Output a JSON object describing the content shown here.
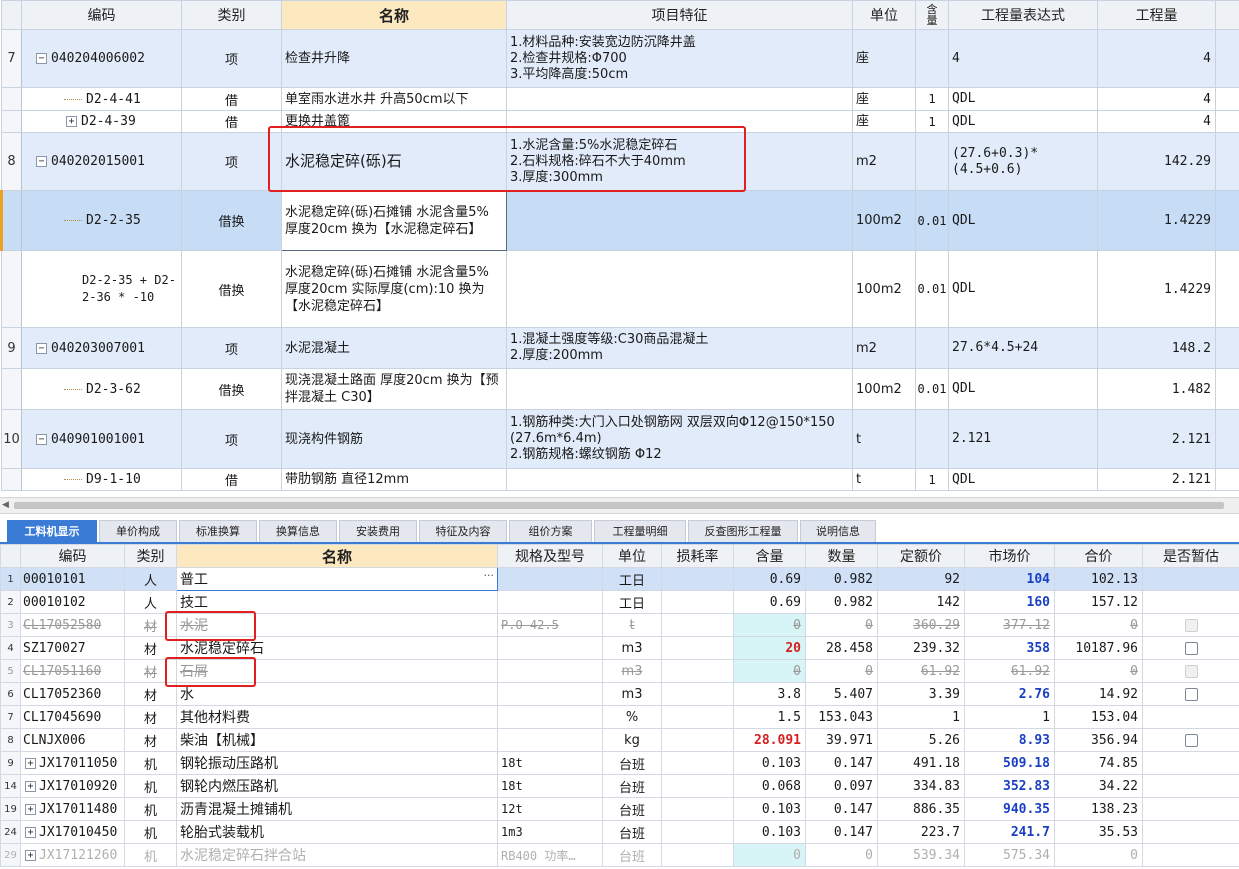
{
  "top": {
    "headers": {
      "code": "编码",
      "type": "类别",
      "name": "名称",
      "feature": "项目特征",
      "unit": "单位",
      "qty_ratio": "含量",
      "expr": "工程量表达式",
      "amount": "工程量"
    },
    "rows": [
      {
        "idx": "7",
        "code": "040204006002",
        "type": "项",
        "name": "检查井升降",
        "feature": "1.材料品种:安装宽边防沉降井盖\n2.检查井规格:Φ700\n3.平均降高度:50cm",
        "unit": "座",
        "ratio": "",
        "expr": "4",
        "amount": "4"
      },
      {
        "idx": "",
        "code": "D2-4-41",
        "type": "借",
        "name": "单室雨水进水井 升高50cm以下",
        "feature": "",
        "unit": "座",
        "ratio": "1",
        "expr": "QDL",
        "amount": "4"
      },
      {
        "idx": "",
        "code": "D2-4-39",
        "type": "借",
        "name": "更换井盖篦",
        "feature": "",
        "unit": "座",
        "ratio": "1",
        "expr": "QDL",
        "amount": "4"
      },
      {
        "idx": "8",
        "code": "040202015001",
        "type": "项",
        "name": "水泥稳定碎(砾)石",
        "feature": "1.水泥含量:5%水泥稳定碎石\n2.石料规格:碎石不大于40mm\n3.厚度:300mm",
        "unit": "m2",
        "ratio": "",
        "expr": "(27.6+0.3)*(4.5+0.6)",
        "amount": "142.29"
      },
      {
        "idx": "",
        "code": "D2-2-35",
        "type": "借换",
        "name": "水泥稳定碎(砾)石摊铺 水泥含量5% 厚度20cm  换为【水泥稳定碎石】",
        "feature": "",
        "unit": "100m2",
        "ratio": "0.01",
        "expr": "QDL",
        "amount": "1.4229"
      },
      {
        "idx": "",
        "code": "D2-2-35 + D2-2-36 * -10",
        "type": "借换",
        "name": "水泥稳定碎(砾)石摊铺 水泥含量5% 厚度20cm  实际厚度(cm):10  换为【水泥稳定碎石】",
        "feature": "",
        "unit": "100m2",
        "ratio": "0.01",
        "expr": "QDL",
        "amount": "1.4229"
      },
      {
        "idx": "9",
        "code": "040203007001",
        "type": "项",
        "name": "水泥混凝土",
        "feature": "1.混凝土强度等级:C30商品混凝土\n2.厚度:200mm",
        "unit": "m2",
        "ratio": "",
        "expr": "27.6*4.5+24",
        "amount": "148.2"
      },
      {
        "idx": "",
        "code": "D2-3-62",
        "type": "借换",
        "name": "现浇混凝土路面 厚度20cm  换为【预拌混凝土 C30】",
        "feature": "",
        "unit": "100m2",
        "ratio": "0.01",
        "expr": "QDL",
        "amount": "1.482"
      },
      {
        "idx": "10",
        "code": "040901001001",
        "type": "项",
        "name": "现浇构件钢筋",
        "feature": "1.钢筋种类:大门入口处钢筋网 双层双向Φ12@150*150 (27.6m*6.4m)\n2.钢筋规格:螺纹钢筋 Φ12",
        "unit": "t",
        "ratio": "",
        "expr": "2.121",
        "amount": "2.121"
      },
      {
        "idx": "",
        "code": "D9-1-10",
        "type": "借",
        "name": "带肋钢筋 直径12mm",
        "feature": "",
        "unit": "t",
        "ratio": "1",
        "expr": "QDL",
        "amount": "2.121"
      }
    ]
  },
  "tabs": [
    "工料机显示",
    "单价构成",
    "标准换算",
    "换算信息",
    "安装费用",
    "特征及内容",
    "组价方案",
    "工程量明细",
    "反查图形工程量",
    "说明信息"
  ],
  "bottom": {
    "headers": {
      "code": "编码",
      "type": "类别",
      "name": "名称",
      "spec": "规格及型号",
      "unit": "单位",
      "loss": "损耗率",
      "content": "含量",
      "qty": "数量",
      "quota_price": "定额价",
      "market_price": "市场价",
      "total": "合价",
      "provisional": "是否暂估"
    },
    "rows": [
      {
        "idx": "1",
        "code": "00010101",
        "type": "人",
        "name": "普工",
        "spec": "",
        "unit": "工日",
        "loss": "",
        "content": "0.69",
        "qty": "0.982",
        "quota": "92",
        "market": "104",
        "total": "102.13"
      },
      {
        "idx": "2",
        "code": "00010102",
        "type": "人",
        "name": "技工",
        "spec": "",
        "unit": "工日",
        "loss": "",
        "content": "0.69",
        "qty": "0.982",
        "quota": "142",
        "market": "160",
        "total": "157.12"
      },
      {
        "idx": "3",
        "code": "CL17052580",
        "type": "材",
        "name": "水泥",
        "spec": "P.O 42.5",
        "unit": "t",
        "loss": "",
        "content": "0",
        "qty": "0",
        "quota": "360.29",
        "market": "377.12",
        "total": "0"
      },
      {
        "idx": "4",
        "code": "SZ170027",
        "type": "材",
        "name": "水泥稳定碎石",
        "spec": "",
        "unit": "m3",
        "loss": "",
        "content": "20",
        "qty": "28.458",
        "quota": "239.32",
        "market": "358",
        "total": "10187.96"
      },
      {
        "idx": "5",
        "code": "CL17051160",
        "type": "材",
        "name": "石屑",
        "spec": "",
        "unit": "m3",
        "loss": "",
        "content": "0",
        "qty": "0",
        "quota": "61.92",
        "market": "61.92",
        "total": "0"
      },
      {
        "idx": "6",
        "code": "CL17052360",
        "type": "材",
        "name": "水",
        "spec": "",
        "unit": "m3",
        "loss": "",
        "content": "3.8",
        "qty": "5.407",
        "quota": "3.39",
        "market": "2.76",
        "total": "14.92"
      },
      {
        "idx": "7",
        "code": "CL17045690",
        "type": "材",
        "name": "其他材料费",
        "spec": "",
        "unit": "%",
        "loss": "",
        "content": "1.5",
        "qty": "153.043",
        "quota": "1",
        "market": "1",
        "total": "153.04"
      },
      {
        "idx": "8",
        "code": "CLNJX006",
        "type": "材",
        "name": "柴油【机械】",
        "spec": "",
        "unit": "kg",
        "loss": "",
        "content": "28.091",
        "qty": "39.971",
        "quota": "5.26",
        "market": "8.93",
        "total": "356.94"
      },
      {
        "idx": "9",
        "code": "JX17011050",
        "type": "机",
        "name": "钢轮振动压路机",
        "spec": "18t",
        "unit": "台班",
        "loss": "",
        "content": "0.103",
        "qty": "0.147",
        "quota": "491.18",
        "market": "509.18",
        "total": "74.85"
      },
      {
        "idx": "14",
        "code": "JX17010920",
        "type": "机",
        "name": "钢轮内燃压路机",
        "spec": "18t",
        "unit": "台班",
        "loss": "",
        "content": "0.068",
        "qty": "0.097",
        "quota": "334.83",
        "market": "352.83",
        "total": "34.22"
      },
      {
        "idx": "19",
        "code": "JX17011480",
        "type": "机",
        "name": "沥青混凝土摊铺机",
        "spec": "12t",
        "unit": "台班",
        "loss": "",
        "content": "0.103",
        "qty": "0.147",
        "quota": "886.35",
        "market": "940.35",
        "total": "138.23"
      },
      {
        "idx": "24",
        "code": "JX17010450",
        "type": "机",
        "name": "轮胎式装载机",
        "spec": "1m3",
        "unit": "台班",
        "loss": "",
        "content": "0.103",
        "qty": "0.147",
        "quota": "223.7",
        "market": "241.7",
        "total": "35.53"
      },
      {
        "idx": "29",
        "code": "JX17121260",
        "type": "机",
        "name": "水泥稳定碎石拌合站",
        "spec": "RB400 功率…",
        "unit": "台班",
        "loss": "",
        "content": "0",
        "qty": "0",
        "quota": "539.34",
        "market": "575.34",
        "total": "0"
      }
    ]
  },
  "colors": {
    "highlight_header": "#fce9c0",
    "row_blue": "#e1ebfa",
    "selected_row": "#c7dcf5",
    "tab_active": "#3a7bd5",
    "annotation_red": "#e02020",
    "market_blue": "#1a3fc4",
    "content_red": "#d42020"
  }
}
